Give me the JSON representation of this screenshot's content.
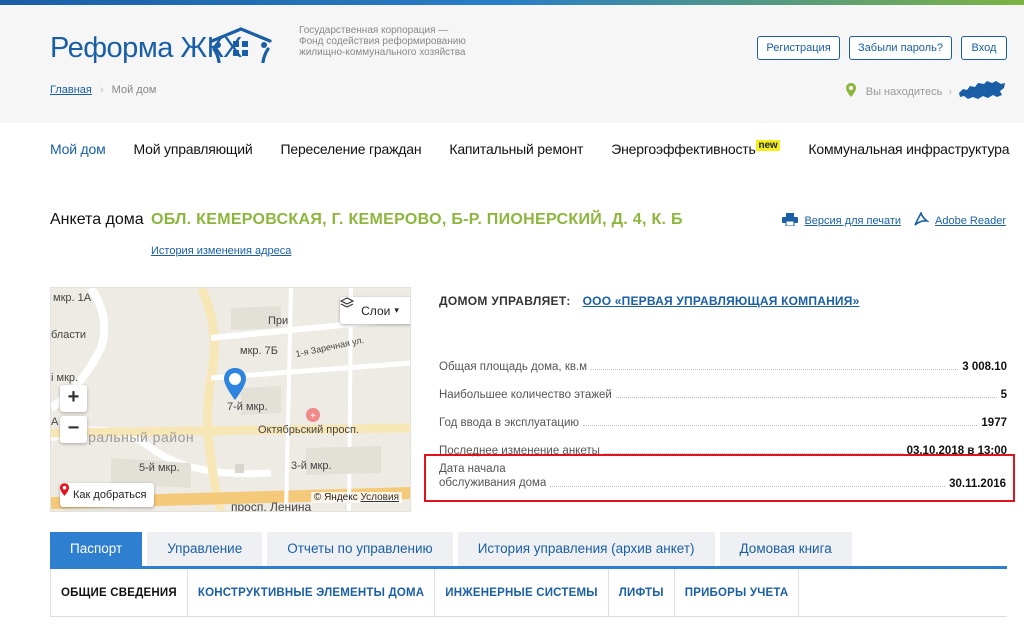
{
  "header": {
    "logo": "Реформа ЖКХ",
    "corp_lines": [
      "Государственная корпорация —",
      "Фонд содействия реформированию",
      "жилищно-коммунального хозяйства"
    ],
    "buttons": {
      "register": "Регистрация",
      "forgot": "Забыли пароль?",
      "login": "Вход"
    },
    "location_text": "Вы находитесь",
    "brand_color": "#1a5fa6",
    "accent_green": "#8db63c"
  },
  "breadcrumb": {
    "home": "Главная",
    "current": "Мой дом"
  },
  "nav": {
    "items": [
      "Мой дом",
      "Мой управляющий",
      "Переселение граждан",
      "Капитальный ремонт",
      "Энергоэффективность",
      "Коммунальная инфраструктура"
    ],
    "new_badge": "new"
  },
  "anketa": {
    "title": "Анкета дома",
    "address": "ОБЛ. КЕМЕРОВСКАЯ, Г. КЕМЕРОВО, Б-Р. ПИОНЕРСКИЙ, Д. 4, К. Б",
    "history_link": "История изменения адреса",
    "print_link": "Версия для печати",
    "reader_link": "Adobe Reader"
  },
  "map": {
    "layers_label": "Слои",
    "route_label": "Как добраться",
    "copyright": "© Яндекс",
    "terms": "Условия",
    "labels": {
      "l1": "мкр. 1А",
      "l2": "бласти",
      "l3": "При",
      "l4": "мкр. 7Б",
      "l5": "1-я Заречная ул.",
      "l6": "і мкр.",
      "l7": "7-й мкр.",
      "l8": "Октябрьский просп.",
      "l9": "5-й мкр.",
      "l10": "3-й мкр.",
      "l11": "просп. Ленина",
      "district": "нтральный район",
      "l12": "А"
    }
  },
  "managed": {
    "label": "ДОМОМ УПРАВЛЯЕТ:",
    "company": "ООО «ПЕРВАЯ УПРАВЛЯЮЩАЯ КОМПАНИЯ»"
  },
  "properties": [
    {
      "key": "Общая площадь дома, кв.м",
      "value": "3 008.10"
    },
    {
      "key": "Наибольшее количество этажей",
      "value": "5"
    },
    {
      "key": "Год ввода в эксплуатацию",
      "value": "1977"
    },
    {
      "key": "Последнее изменение анкеты",
      "value": "03.10.2018 в 13:00"
    }
  ],
  "highlight": {
    "key_line1": "Дата начала",
    "key_line2": "обслуживания дома",
    "value": "30.11.2016",
    "border_color": "#e1141c"
  },
  "tabs": [
    "Паспорт",
    "Управление",
    "Отчеты по управлению",
    "История управления (архив анкет)",
    "Домовая книга"
  ],
  "subtabs": [
    "ОБЩИЕ СВЕДЕНИЯ",
    "КОНСТРУКТИВНЫЕ ЭЛЕМЕНТЫ ДОМА",
    "ИНЖЕНЕРНЫЕ СИСТЕМЫ",
    "ЛИФТЫ",
    "ПРИБОРЫ УЧЕТА"
  ]
}
